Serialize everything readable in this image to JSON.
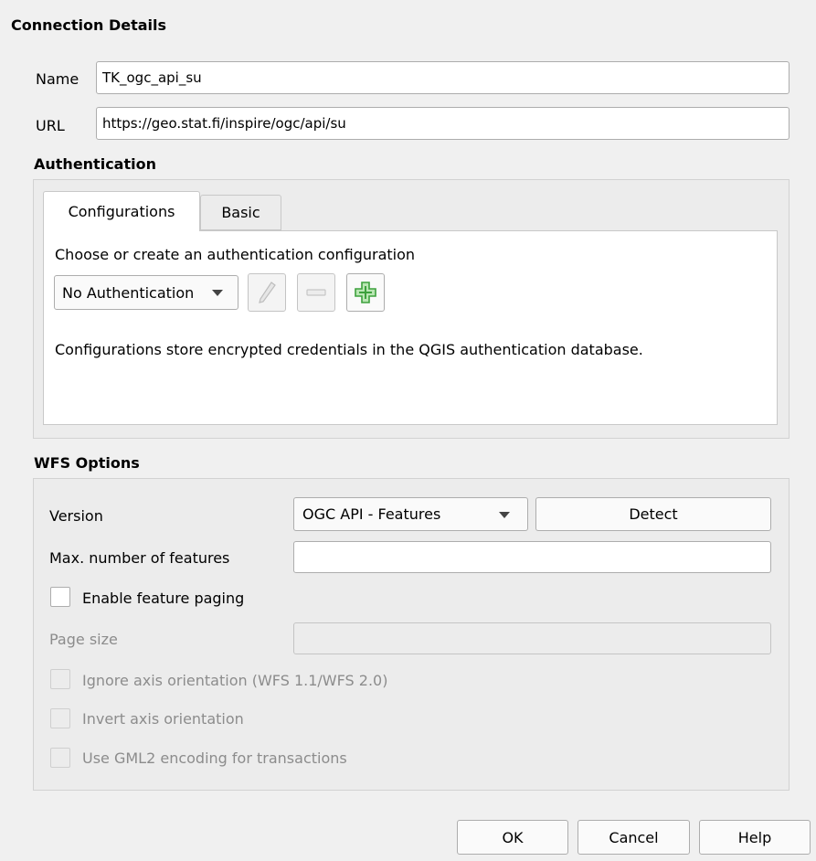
{
  "connection": {
    "section_title": "Connection Details",
    "name_label": "Name",
    "name_value": "TK_ogc_api_su",
    "url_label": "URL",
    "url_value": "https://geo.stat.fi/inspire/ogc/api/su"
  },
  "authentication": {
    "section_title": "Authentication",
    "tabs": [
      {
        "label": "Configurations",
        "active": true
      },
      {
        "label": "Basic",
        "active": false
      }
    ],
    "choose_text": "Choose or create an authentication configuration",
    "dropdown_value": "No Authentication",
    "info_text": "Configurations store encrypted credentials in the QGIS authentication database.",
    "icons": {
      "edit": "pencil-icon",
      "remove": "minus-icon",
      "add": "plus-icon"
    },
    "add_icon_color": "#3da13d"
  },
  "wfs": {
    "section_title": "WFS Options",
    "version_label": "Version",
    "version_value": "OGC API - Features",
    "detect_label": "Detect",
    "max_features_label": "Max. number of features",
    "max_features_value": "",
    "enable_paging_label": "Enable feature paging",
    "page_size_label": "Page size",
    "page_size_value": "",
    "ignore_axis_label": "Ignore axis orientation (WFS 1.1/WFS 2.0)",
    "invert_axis_label": "Invert axis orientation",
    "gml2_label": "Use GML2 encoding for transactions"
  },
  "buttons": {
    "ok": "OK",
    "cancel": "Cancel",
    "help": "Help"
  }
}
